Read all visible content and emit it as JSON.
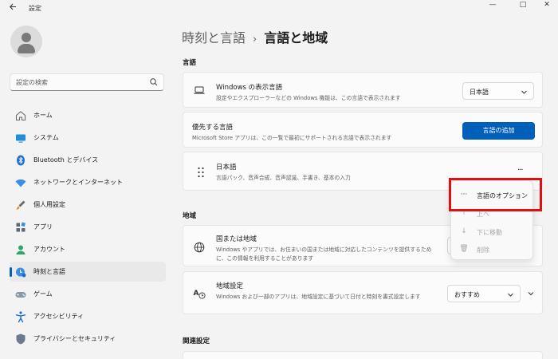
{
  "window": {
    "title": "設定",
    "back_icon": "back-arrow-icon",
    "min_glyph": "—",
    "max_glyph": "□",
    "close_glyph": "✕"
  },
  "sidebar": {
    "search_placeholder": "設定の検索",
    "items": [
      {
        "label": "ホーム",
        "icon": "home-icon"
      },
      {
        "label": "システム",
        "icon": "system-icon"
      },
      {
        "label": "Bluetooth とデバイス",
        "icon": "bluetooth-icon"
      },
      {
        "label": "ネットワークとインターネット",
        "icon": "wifi-icon"
      },
      {
        "label": "個人用設定",
        "icon": "brush-icon"
      },
      {
        "label": "アプリ",
        "icon": "apps-icon"
      },
      {
        "label": "アカウント",
        "icon": "account-icon"
      },
      {
        "label": "時刻と言語",
        "icon": "time-language-icon",
        "active": true
      },
      {
        "label": "ゲーム",
        "icon": "gamepad-icon"
      },
      {
        "label": "アクセシビリティ",
        "icon": "accessibility-icon"
      },
      {
        "label": "プライバシーとセキュリティ",
        "icon": "shield-icon"
      }
    ]
  },
  "main": {
    "breadcrumb_parent": "時刻と言語",
    "breadcrumb_sep": "›",
    "breadcrumb_current": "言語と地域",
    "language_section": {
      "title": "言語",
      "display_language": {
        "title": "Windows の表示言語",
        "subtitle": "設定やエクスプローラーなどの Windows 機能は、この言語で表示されます",
        "value": "日本語"
      },
      "preferred_languages": {
        "title": "優先する言語",
        "subtitle": "Microsoft Store アプリは、この一覧で最初にサポートされる言語で表示されます",
        "button": "言語の追加"
      },
      "japanese": {
        "title": "日本語",
        "subtitle": "言語パック、音声合成、音声認識、手書き、基本の入力",
        "more": "···"
      }
    },
    "region_section": {
      "title": "地域",
      "country": {
        "title": "国または地域",
        "subtitle_line1": "Windows やアプリでは、お住まいの国または地域に対応したコンテンツを提供するため",
        "subtitle_line2": "に、この情報を利用することがあります"
      },
      "regional_format": {
        "title": "地域設定",
        "subtitle": "Windows および一部のアプリは、地域設定に基づいて日付と時刻を書式設定します",
        "value": "おすすめ"
      }
    },
    "related_section": {
      "title": "関連設定"
    }
  },
  "context_menu": {
    "items": [
      {
        "label": "言語のオプション",
        "icon": "···",
        "enabled": true
      },
      {
        "label": "上へ",
        "icon": "↑",
        "enabled": false
      },
      {
        "label": "下に移動",
        "icon": "↓",
        "enabled": false
      },
      {
        "label": "削除",
        "icon": "🗑",
        "enabled": false
      }
    ]
  },
  "colors": {
    "accent": "#005fb8",
    "highlight": "#e01010"
  }
}
